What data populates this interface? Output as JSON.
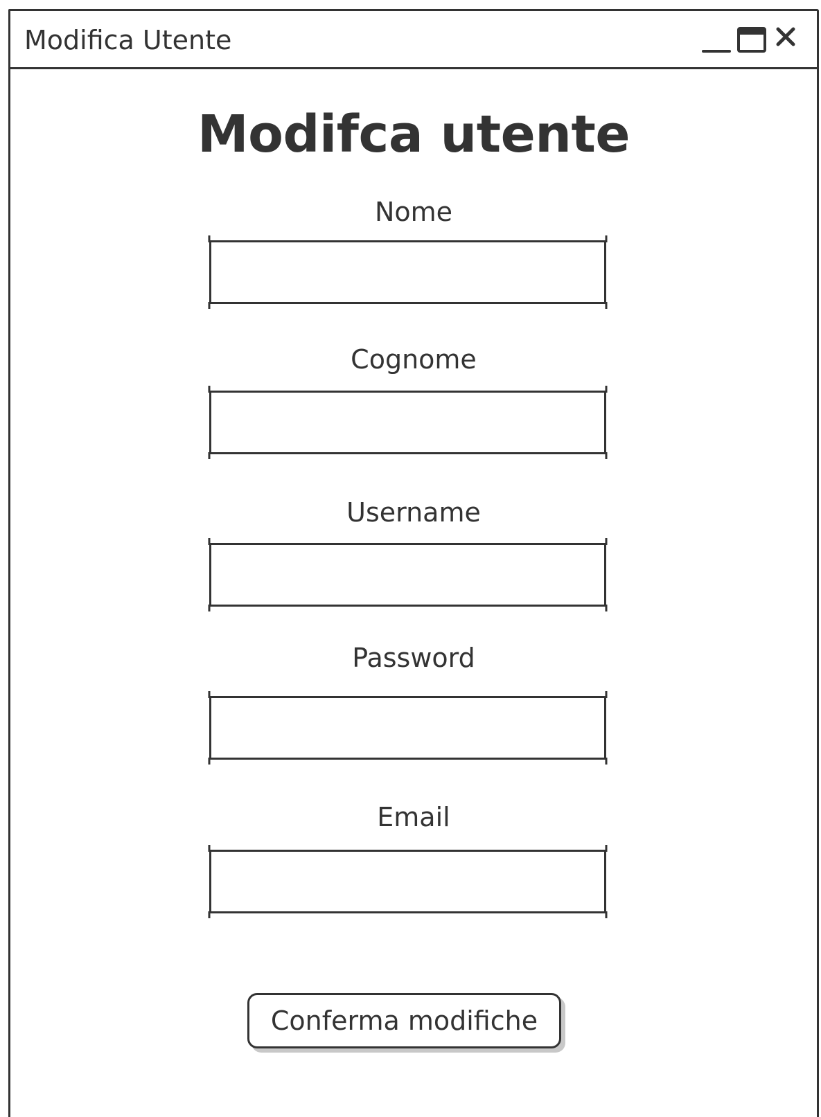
{
  "window": {
    "title": "Modifica Utente",
    "controls": [
      {
        "name": "minimize",
        "icon": "minimize-icon"
      },
      {
        "name": "maximize",
        "icon": "maximize-icon"
      },
      {
        "name": "close",
        "icon": "close-icon"
      }
    ]
  },
  "form": {
    "heading": "Modifca utente",
    "fields": [
      {
        "label": "Nome",
        "value": "",
        "placeholder": ""
      },
      {
        "label": "Cognome",
        "value": "",
        "placeholder": ""
      },
      {
        "label": "Username",
        "value": "",
        "placeholder": ""
      },
      {
        "label": "Password",
        "value": "",
        "placeholder": ""
      },
      {
        "label": "Email",
        "value": "",
        "placeholder": ""
      }
    ],
    "submit_label": "Conferma modifiche"
  },
  "colors": {
    "stroke": "#333333",
    "background": "#ffffff",
    "button_shadow": "#c8c8c8"
  }
}
